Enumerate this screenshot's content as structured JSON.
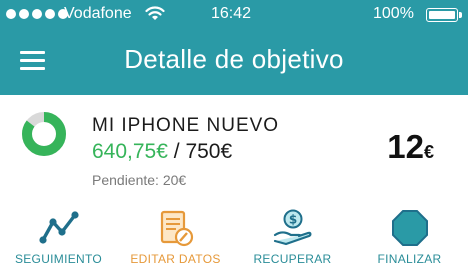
{
  "status_bar": {
    "carrier": "Vodafone",
    "time": "16:42",
    "battery": "100%"
  },
  "header": {
    "title": "Detalle de objetivo"
  },
  "goal": {
    "name": "MI IPHONE NUEVO",
    "saved": "640,75€",
    "separator": " / ",
    "total": "750€",
    "pending_label": "Pendiente: 20€",
    "progress": 0.854,
    "quota_value": "12",
    "quota_currency": "€"
  },
  "actions": [
    {
      "label": "SEGUIMIENTO",
      "icon": "trend-chart-icon"
    },
    {
      "label": "EDITAR DATOS",
      "icon": "edit-document-icon"
    },
    {
      "label": "RECUPERAR",
      "icon": "money-hand-icon"
    },
    {
      "label": "FINALIZAR",
      "icon": "stop-octagon-icon"
    }
  ],
  "colors": {
    "brand": "#2a9aa6",
    "saved_amount": "#36b45a",
    "progress_track": "#d9d9d9",
    "action_label": "#2a8d98",
    "edit_label": "#e6993a"
  }
}
